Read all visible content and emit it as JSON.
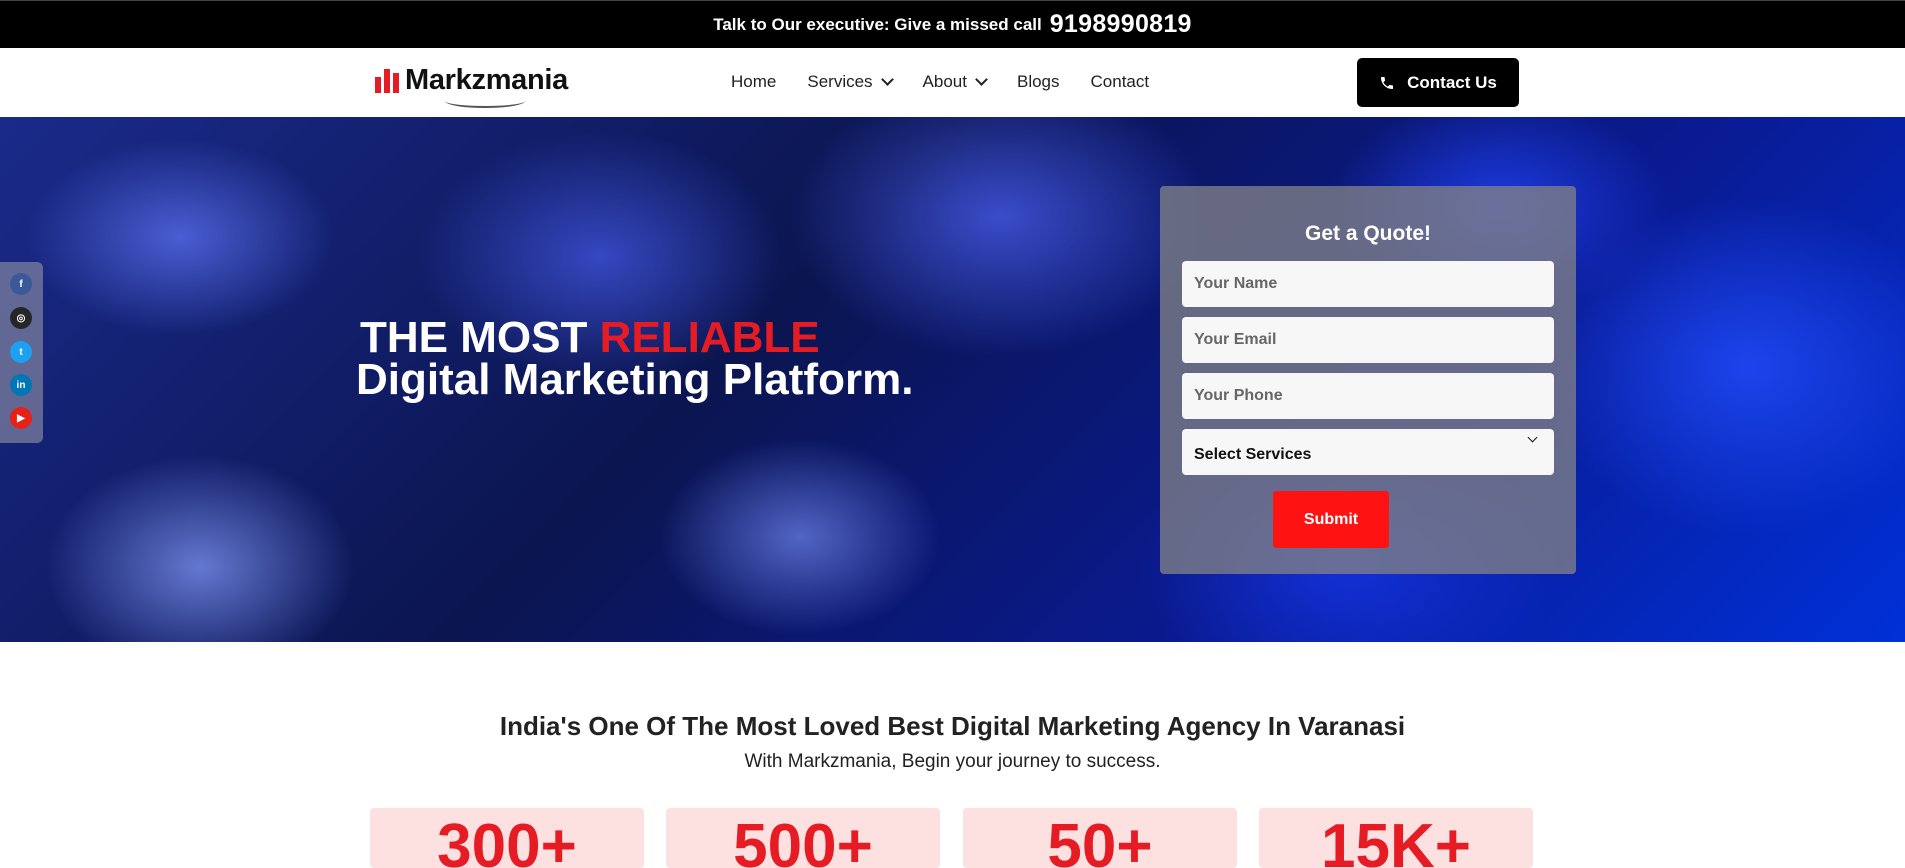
{
  "topbar": {
    "message": "Talk to Our executive: Give a missed call",
    "phone": "9198990819"
  },
  "logo": {
    "text": "Markzmania"
  },
  "nav": {
    "items": [
      "Home",
      "Services",
      "About",
      "Blogs",
      "Contact"
    ]
  },
  "contact_button": {
    "label": "Contact Us"
  },
  "hero": {
    "title_prefix": "THE MOST ",
    "title_highlight": "RELIABLE",
    "title_line2": "Digital Marketing Platform."
  },
  "social": [
    "facebook-icon",
    "instagram-icon",
    "twitter-icon",
    "linkedin-icon",
    "youtube-icon"
  ],
  "quote_form": {
    "title": "Get a Quote!",
    "name_placeholder": "Your Name",
    "email_placeholder": "Your Email",
    "phone_placeholder": "Your Phone",
    "service_selected": "Select Services",
    "submit_label": "Submit"
  },
  "section": {
    "title": "India's One Of The Most Loved Best Digital Marketing Agency In Varanasi",
    "subtitle": "With Markzmania, Begin your journey to success."
  },
  "stats": [
    "300+",
    "500+",
    "50+",
    "15K+"
  ],
  "colors": {
    "accent": "#e61c24",
    "dark": "#000000"
  }
}
